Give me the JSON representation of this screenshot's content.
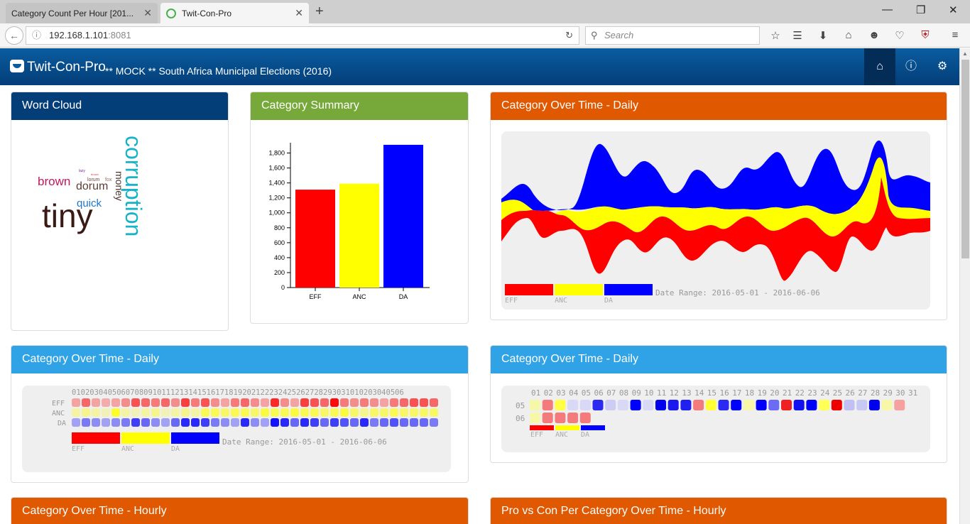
{
  "browser": {
    "tabs": [
      {
        "title": "Category Count Per Hour [201...",
        "active": false
      },
      {
        "title": "Twit-Con-Pro",
        "active": true
      }
    ],
    "url_host": "192.168.1.101",
    "url_port": ":8081",
    "search_placeholder": "Search"
  },
  "app": {
    "brand": "Twit-Con-Pro",
    "subtitle": "** MOCK ** South Africa Municipal Elections (2016)"
  },
  "panels": {
    "word_cloud": {
      "title": "Word Cloud",
      "words": [
        {
          "text": "corruption",
          "color": "#17b3c9"
        },
        {
          "text": "tiny",
          "color": "#3a1a14"
        },
        {
          "text": "brown",
          "color": "#c2185b"
        },
        {
          "text": "dorum",
          "color": "#5d4037"
        },
        {
          "text": "money",
          "color": "#4e342e"
        },
        {
          "text": "quick",
          "color": "#1976d2"
        },
        {
          "text": "fox",
          "color": "#8d6e63"
        },
        {
          "text": "lorum",
          "color": "#6d4c41"
        },
        {
          "text": "lazy",
          "color": "#7b1fa2"
        },
        {
          "text": "brown",
          "color": "#e53935"
        }
      ]
    },
    "category_summary": {
      "title": "Category Summary"
    },
    "daily_stream": {
      "title": "Category Over Time - Daily",
      "date_range": "Date Range: 2016-05-01 - 2016-06-06"
    },
    "daily_heat": {
      "title": "Category Over Time - Daily",
      "date_range": "Date Range: 2016-05-01 - 2016-06-06",
      "header": "01020304050607080910111213141516171819202122232425262728293031010203040506",
      "rows": [
        "EFF",
        "ANC",
        "DA"
      ]
    },
    "daily_calendar": {
      "title": "Category Over Time - Daily",
      "days": [
        "01",
        "02",
        "03",
        "04",
        "05",
        "06",
        "07",
        "08",
        "09",
        "10",
        "11",
        "12",
        "13",
        "14",
        "15",
        "16",
        "17",
        "18",
        "19",
        "20",
        "21",
        "22",
        "23",
        "24",
        "25",
        "26",
        "27",
        "28",
        "29",
        "30",
        "31"
      ],
      "months": [
        "05",
        "06"
      ]
    },
    "hourly": {
      "title": "Category Over Time - Hourly"
    },
    "pro_con": {
      "title": "Pro vs Con Per Category Over Time - Hourly"
    }
  },
  "legend": [
    {
      "label": "EFF",
      "color": "#ff0000"
    },
    {
      "label": "ANC",
      "color": "#ffff00"
    },
    {
      "label": "DA",
      "color": "#0000ff"
    }
  ],
  "chart_data": {
    "type": "bar",
    "categories": [
      "EFF",
      "ANC",
      "DA"
    ],
    "values": [
      1310,
      1390,
      1910
    ],
    "colors": [
      "#ff0000",
      "#ffff00",
      "#0000ff"
    ],
    "ylim": [
      0,
      1900
    ],
    "yticks": [
      "0",
      "200",
      "400",
      "600",
      "800",
      "1,000",
      "1,200",
      "1,400",
      "1,600",
      "1,800"
    ]
  }
}
